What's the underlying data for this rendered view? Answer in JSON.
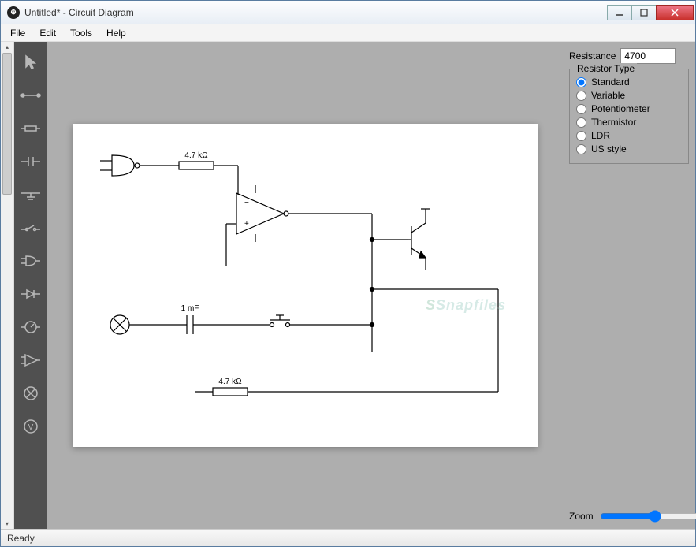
{
  "window": {
    "title": "Untitled* - Circuit Diagram"
  },
  "menu": {
    "file": "File",
    "edit": "Edit",
    "tools": "Tools",
    "help": "Help"
  },
  "tools": {
    "pointer": "pointer",
    "wire": "wire",
    "resistor": "resistor",
    "capacitor": "capacitor",
    "ground": "ground",
    "switch": "switch",
    "gate": "gate",
    "diode": "diode",
    "meter": "meter",
    "opamp": "opamp",
    "lamp": "lamp",
    "voltmeter": "voltmeter"
  },
  "properties": {
    "resistance_label": "Resistance",
    "resistance_value": "4700",
    "group_label": "Resistor Type",
    "options": {
      "standard": "Standard",
      "variable": "Variable",
      "potentiometer": "Potentiometer",
      "thermistor": "Thermistor",
      "ldr": "LDR",
      "us_style": "US style"
    },
    "selected": "standard"
  },
  "zoom": {
    "label": "Zoom"
  },
  "status": {
    "text": "Ready"
  },
  "circuit": {
    "r1_label": "4.7 kΩ",
    "r2_label": "4.7 kΩ",
    "c1_label": "1 mF"
  },
  "watermark": {
    "text": "Snapfiles"
  }
}
